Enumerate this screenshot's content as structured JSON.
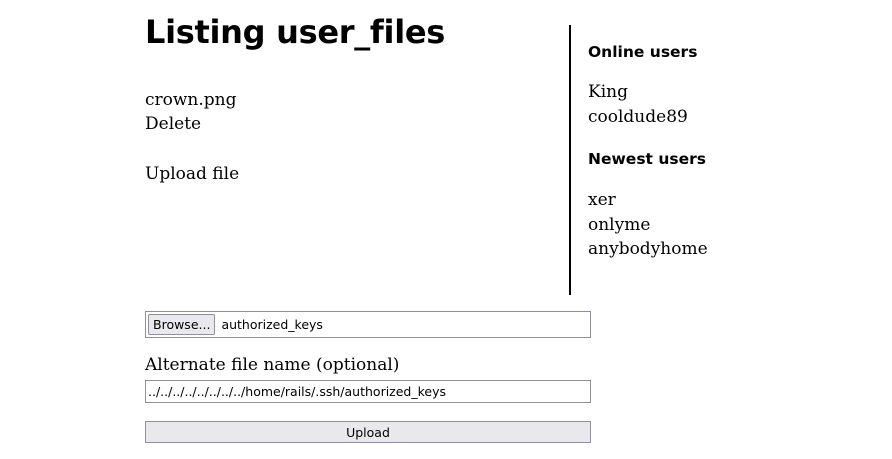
{
  "main": {
    "title": "Listing user_files",
    "files": [
      {
        "name": "crown.png",
        "delete_label": "Delete"
      }
    ],
    "upload_link": "Upload file"
  },
  "sidebar": {
    "online_heading": "Online users",
    "online_users": [
      "King",
      "cooldude89"
    ],
    "newest_heading": "Newest users",
    "newest_users": [
      "xer",
      "onlyme",
      "anybodyhome"
    ]
  },
  "form": {
    "browse_label": "Browse...",
    "selected_file": "authorized_keys",
    "alt_label": "Alternate file name (optional)",
    "alt_value": "../../../../../../../../home/rails/.ssh/authorized_keys",
    "submit_label": "Upload"
  }
}
